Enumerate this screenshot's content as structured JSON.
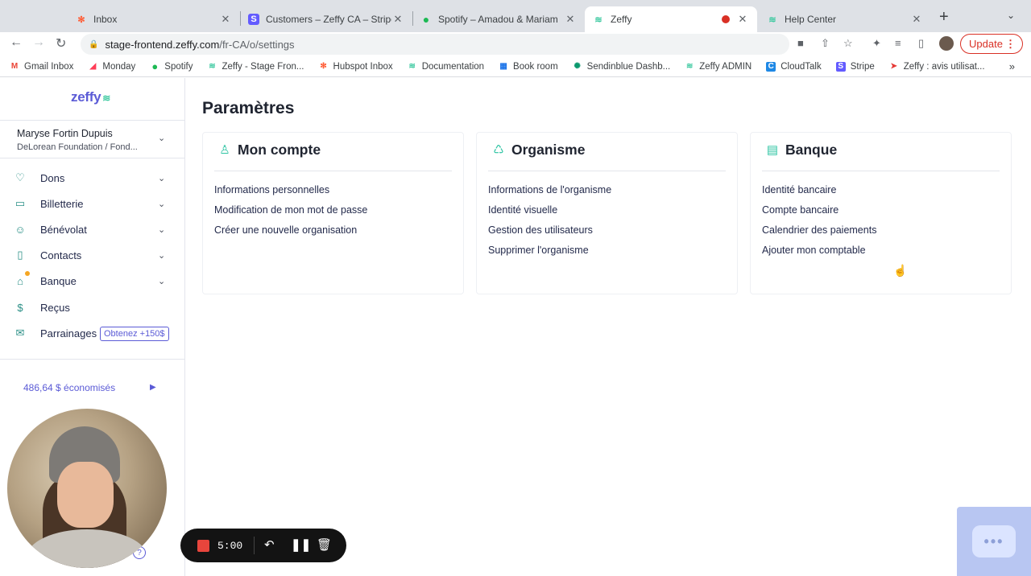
{
  "browser": {
    "tabs": [
      {
        "title": "Inbox",
        "favicon": "hubspot-icon",
        "color": "#ff5c35",
        "glyph": "✻"
      },
      {
        "title": "Customers – Zeffy CA – Stripe",
        "favicon": "stripe-icon",
        "color": "#635bff",
        "glyph": "S"
      },
      {
        "title": "Spotify – Amadou & Mariam",
        "favicon": "spotify-icon",
        "color": "#1db954",
        "glyph": "●"
      },
      {
        "title": "Zeffy",
        "favicon": "zeffy-icon",
        "color": "#3cc9a0",
        "glyph": "≋"
      },
      {
        "title": "Help Center",
        "favicon": "zeffy-icon",
        "color": "#3cc9a0",
        "glyph": "≋"
      }
    ],
    "url_main": "stage-frontend.zeffy.com",
    "url_rest": "/fr-CA/o/settings",
    "update_label": "Update",
    "bookmarks": [
      {
        "label": "Gmail Inbox",
        "glyph": "M",
        "color": "#ea4335"
      },
      {
        "label": "Monday",
        "glyph": "◢",
        "color": "#ff3d57"
      },
      {
        "label": "Spotify",
        "glyph": "●",
        "color": "#1db954"
      },
      {
        "label": "Zeffy - Stage Fron...",
        "glyph": "≋",
        "color": "#3cc9a0"
      },
      {
        "label": "Hubspot Inbox",
        "glyph": "✻",
        "color": "#ff5c35"
      },
      {
        "label": "Documentation",
        "glyph": "≋",
        "color": "#3cc9a0"
      },
      {
        "label": "Book room",
        "glyph": "▦",
        "color": "#1a73e8"
      },
      {
        "label": "Sendinblue Dashb...",
        "glyph": "✺",
        "color": "#0b996e"
      },
      {
        "label": "Zeffy ADMIN",
        "glyph": "≋",
        "color": "#3cc9a0"
      },
      {
        "label": "CloudTalk",
        "glyph": "C",
        "color": "#1e88e5"
      },
      {
        "label": "Stripe",
        "glyph": "S",
        "color": "#635bff"
      },
      {
        "label": "Zeffy : avis utilisat...",
        "glyph": "➤",
        "color": "#e53935"
      }
    ]
  },
  "sidebar": {
    "logo": "zeffy",
    "org_name": "Maryse Fortin Dupuis",
    "org_sub": "DeLorean Foundation / Fond...",
    "items": [
      {
        "label": "Dons",
        "icon": "donation-hand-icon",
        "glyph": "♡",
        "chevron": true
      },
      {
        "label": "Billetterie",
        "icon": "ticket-icon",
        "glyph": "▭",
        "chevron": true
      },
      {
        "label": "Bénévolat",
        "icon": "people-icon",
        "glyph": "☺",
        "chevron": true
      },
      {
        "label": "Contacts",
        "icon": "contact-card-icon",
        "glyph": "▯",
        "chevron": true
      },
      {
        "label": "Banque",
        "icon": "bank-icon",
        "glyph": "⌂",
        "chevron": true
      },
      {
        "label": "Reçus",
        "icon": "receipt-icon",
        "glyph": "$",
        "chevron": false
      },
      {
        "label": "Parrainages",
        "icon": "gift-icon",
        "glyph": "✉",
        "chevron": false
      }
    ],
    "referral_badge": "Obtenez +150$",
    "savings": "486,64 $ économisés"
  },
  "main": {
    "title": "Paramètres",
    "cards": [
      {
        "title": "Mon compte",
        "icon": "user-icon",
        "glyph": "♙",
        "links": [
          "Informations personnelles",
          "Modification de mon mot de passe",
          "Créer une nouvelle organisation"
        ]
      },
      {
        "title": "Organisme",
        "icon": "organization-icon",
        "glyph": "♺",
        "links": [
          "Informations de l'organisme",
          "Identité visuelle",
          "Gestion des utilisateurs",
          "Supprimer l'organisme"
        ]
      },
      {
        "title": "Banque",
        "icon": "bank-card-icon",
        "glyph": "▤",
        "links": [
          "Identité bancaire",
          "Compte bancaire",
          "Calendrier des paiements",
          "Ajouter mon comptable"
        ]
      }
    ]
  },
  "recorder": {
    "time": "5:00"
  }
}
